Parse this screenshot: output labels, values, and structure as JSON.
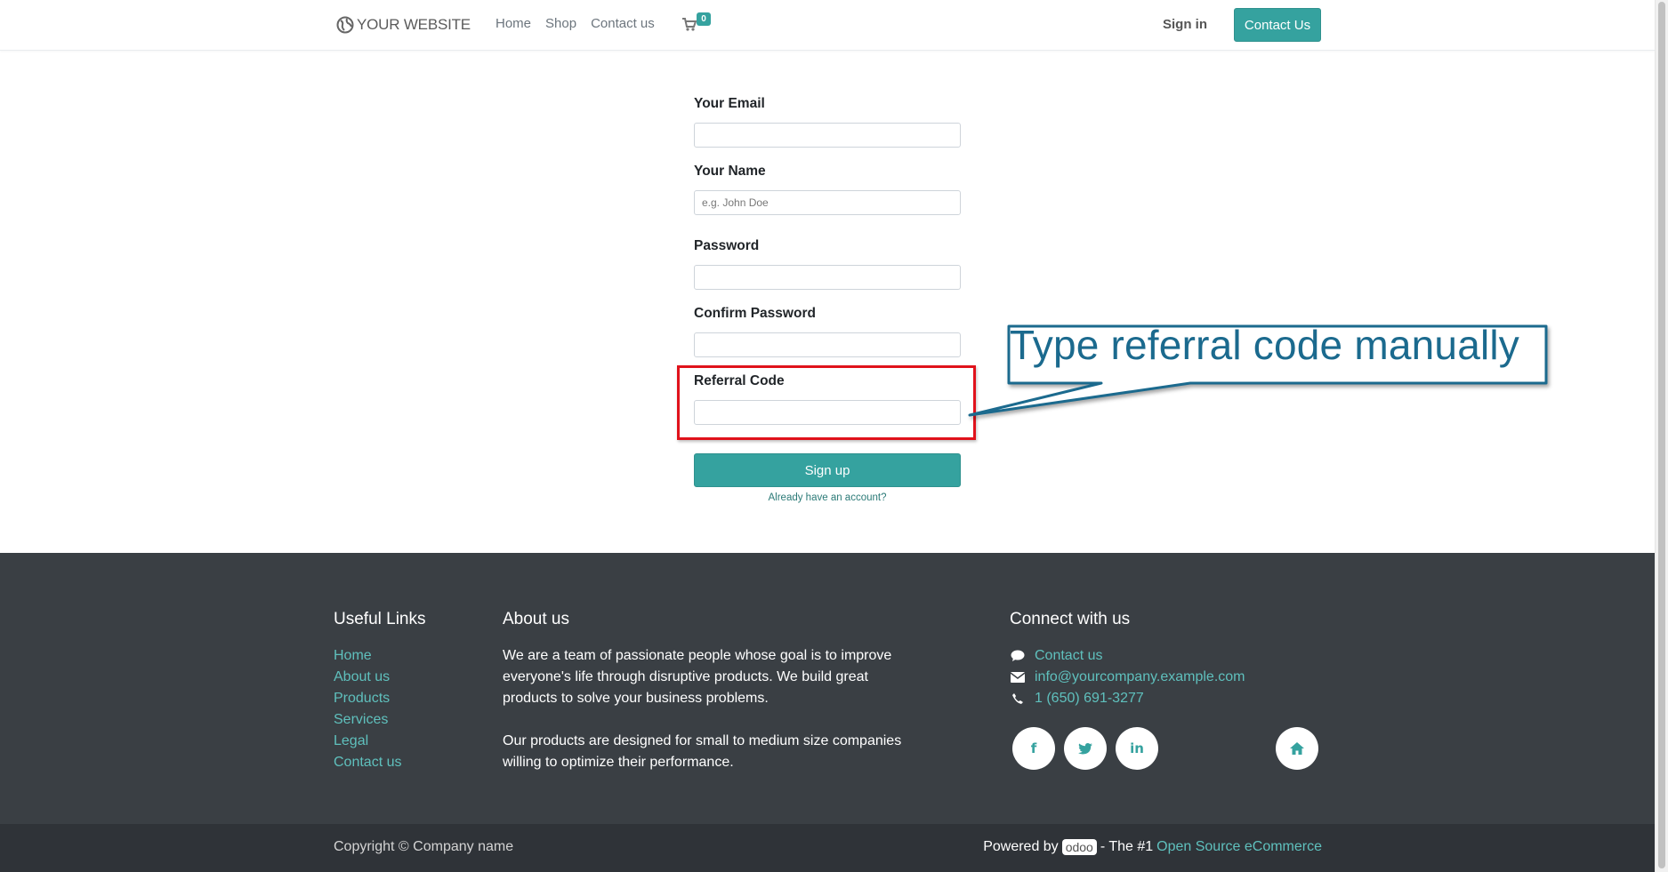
{
  "header": {
    "brand": "YOUR WEBSITE",
    "brand_icon": "globe-icon",
    "nav": [
      "Home",
      "Shop",
      "Contact us"
    ],
    "cart_count": "0",
    "signin": "Sign in",
    "contact_button": "Contact Us"
  },
  "form": {
    "email_label": "Your Email",
    "email_value": "",
    "name_label": "Your Name",
    "name_placeholder": "e.g. John Doe",
    "password_label": "Password",
    "confirm_label": "Confirm Password",
    "referral_label": "Referral Code",
    "referral_value": "",
    "signup_button": "Sign up",
    "have_account_link": "Already have an account?"
  },
  "annotation": {
    "callout_text": "Type referral code manually",
    "highlight_color": "#e0121b",
    "callout_color": "#1b6a8e"
  },
  "footer": {
    "useful_links_title": "Useful Links",
    "useful_links": [
      "Home",
      "About us",
      "Products",
      "Services",
      "Legal",
      "Contact us"
    ],
    "about_title": "About us",
    "about_p1": "We are a team of passionate people whose goal is to improve everyone's life through disruptive products. We build great products to solve your business problems.",
    "about_p2": "Our products are designed for small to medium size companies willing to optimize their performance.",
    "connect_title": "Connect with us",
    "connect_items": [
      {
        "icon": "comment-icon",
        "text": "Contact us"
      },
      {
        "icon": "envelope-icon",
        "text": "info@yourcompany.example.com"
      },
      {
        "icon": "phone-icon",
        "text": "1 (650) 691-3277"
      }
    ],
    "social": {
      "facebook": "f",
      "twitter": "twitter-icon",
      "linkedin": "in",
      "home": "home-icon"
    },
    "copyright": "Copyright © Company name",
    "powered_by": "Powered by",
    "powered_logo": "odoo",
    "powered_mid": "- The #1",
    "powered_link": "Open Source eCommerce"
  },
  "colors": {
    "accent": "#35a29f",
    "footer_bg": "#3a3f44",
    "footer_link": "#5fc0bd"
  }
}
